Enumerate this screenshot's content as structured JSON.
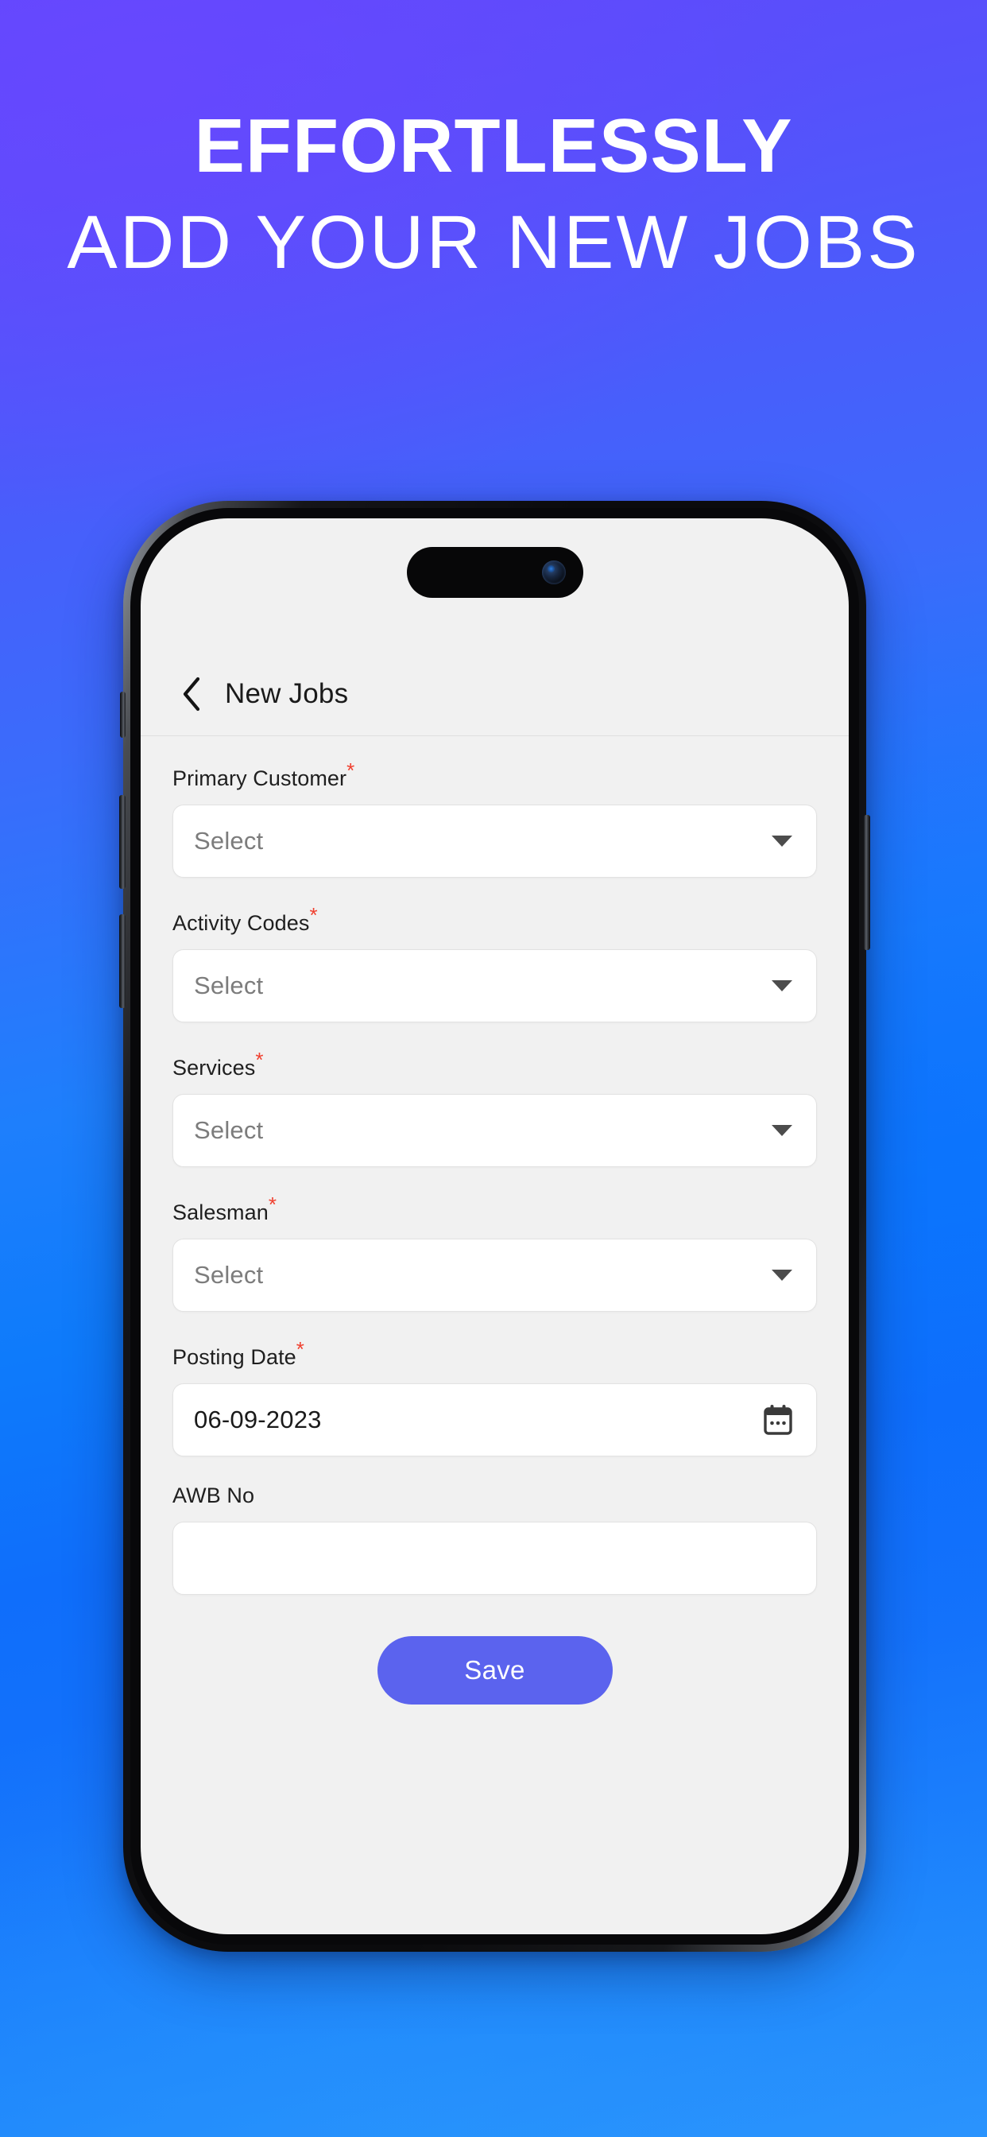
{
  "promo": {
    "line1": "EFFORTLESSLY",
    "line2": "ADD YOUR NEW JOBS",
    "background_from": "#5A4DFB",
    "background_to": "#2B93FD",
    "text_color": "#FFFFFF"
  },
  "phone": {
    "frame_color": "#08080A",
    "screen_background": "#F1F1F1",
    "dynamic_island": "dynamic-island",
    "camera": "front-camera"
  },
  "app": {
    "header": {
      "back_icon": "chevron-left-icon",
      "title": "New Jobs"
    },
    "form": {
      "required_marker": "*",
      "fields": [
        {
          "label": "Primary Customer",
          "required": true,
          "type": "select",
          "value": "Select",
          "is_placeholder": true,
          "icon": "chevron-down-icon"
        },
        {
          "label": "Activity Codes",
          "required": true,
          "type": "select",
          "value": "Select",
          "is_placeholder": true,
          "icon": "chevron-down-icon"
        },
        {
          "label": "Services",
          "required": true,
          "type": "select",
          "value": "Select",
          "is_placeholder": true,
          "icon": "chevron-down-icon"
        },
        {
          "label": "Salesman",
          "required": true,
          "type": "select",
          "value": "Select",
          "is_placeholder": true,
          "icon": "chevron-down-icon"
        },
        {
          "label": "Posting Date",
          "required": true,
          "type": "date",
          "value": "06-09-2023",
          "is_placeholder": false,
          "icon": "calendar-icon"
        },
        {
          "label": "AWB No",
          "required": false,
          "type": "text",
          "value": "",
          "is_placeholder": true,
          "icon": null
        }
      ],
      "submit": {
        "label": "Save",
        "color": "#5B63EE",
        "text_color": "#FFFFFF"
      }
    }
  }
}
